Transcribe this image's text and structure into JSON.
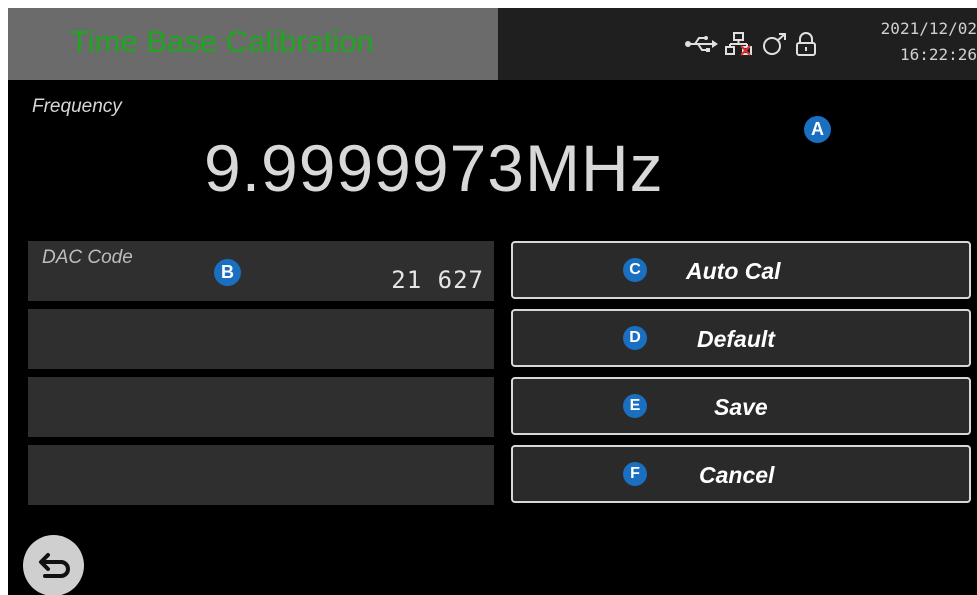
{
  "header": {
    "title": "Time Base Calibration",
    "date": "2021/12/02",
    "time": "16:22:26",
    "status_icons": [
      "usb-icon",
      "network-disconnected-icon",
      "external-reference-icon",
      "unlock-icon"
    ]
  },
  "frequency": {
    "label": "Frequency",
    "value": "9.9999973MHz",
    "badge": "A"
  },
  "fields": [
    {
      "label": "DAC Code",
      "value": "21 627",
      "badge": "B"
    },
    {
      "label": "",
      "value": ""
    },
    {
      "label": "",
      "value": ""
    },
    {
      "label": "",
      "value": ""
    }
  ],
  "buttons": [
    {
      "badge": "C",
      "label": "Auto Cal"
    },
    {
      "badge": "D",
      "label": "Default"
    },
    {
      "badge": "E",
      "label": "Save"
    },
    {
      "badge": "F",
      "label": "Cancel"
    }
  ],
  "colors": {
    "title_green": "#1fa51f",
    "badge_blue": "#1a6fc0",
    "background": "#000000"
  },
  "back_button": {
    "icon": "back-arrow-icon"
  }
}
